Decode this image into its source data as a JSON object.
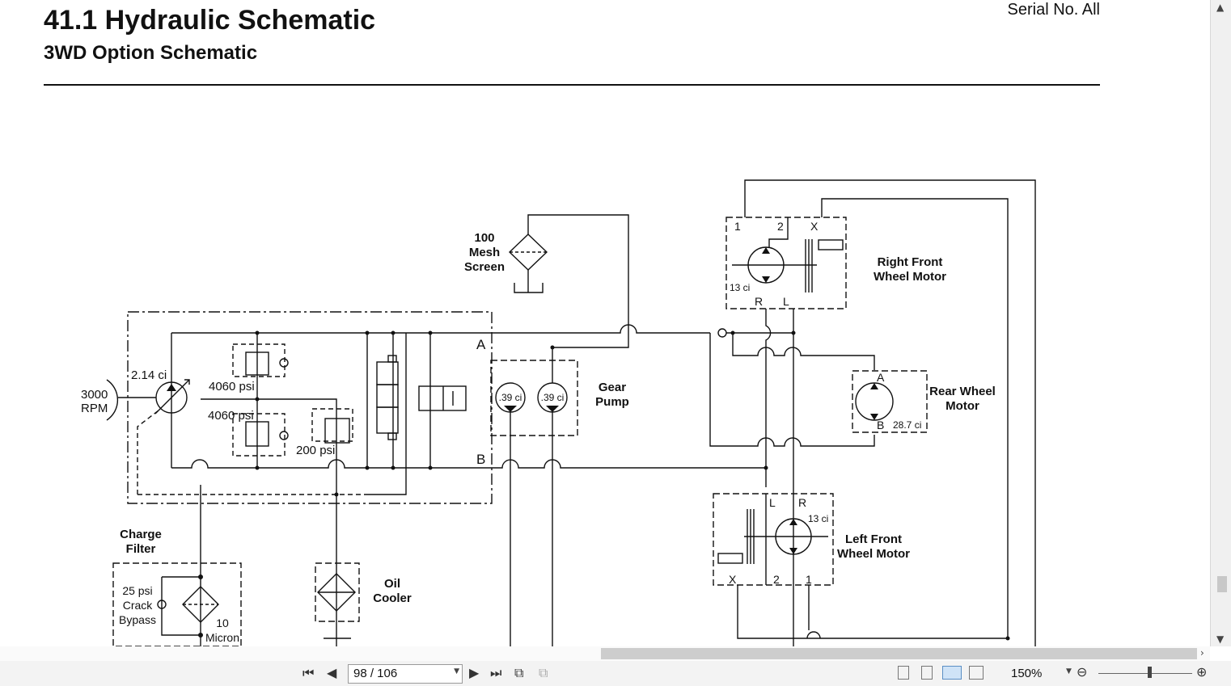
{
  "header": {
    "title": "41.1 Hydraulic Schematic",
    "subtitle": "3WD Option Schematic",
    "serial": "Serial No. All"
  },
  "schematic": {
    "labels": {
      "rpm_value": "3000",
      "rpm_unit": "RPM",
      "pump_disp": "2.14 ci",
      "relief_upper": "4060 psi",
      "relief_lower": "4060 psi",
      "relief_charge": "200 psi",
      "port_a": "A",
      "port_b": "B",
      "mesh_line1": "100",
      "mesh_line2": "Mesh",
      "mesh_line3": "Screen",
      "gear_pump_line1": "Gear",
      "gear_pump_line2": "Pump",
      "gear_disp_1": ".39 ci",
      "gear_disp_2": ".39 ci",
      "rf_port_1": "1",
      "rf_port_2": "2",
      "rf_port_x": "X",
      "rf_port_r": "R",
      "rf_port_l": "L",
      "rf_disp": "13 ci",
      "rf_line1": "Right Front",
      "rf_line2": "Wheel Motor",
      "rear_port_a": "A",
      "rear_port_b": "B",
      "rear_disp": "28.7 ci",
      "rear_line1": "Rear Wheel",
      "rear_line2": "Motor",
      "lf_port_l": "L",
      "lf_port_r": "R",
      "lf_port_x": "X",
      "lf_port_2": "2",
      "lf_port_1": "1",
      "lf_disp": "13 ci",
      "lf_line1": "Left Front",
      "lf_line2": "Wheel Motor",
      "charge_line1": "Charge",
      "charge_line2": "Filter",
      "bypass_line1": "25 psi",
      "bypass_line2": "Crack",
      "bypass_line3": "Bypass",
      "micron_value": "10",
      "micron_unit": "Micron",
      "cooler_line1": "Oil",
      "cooler_line2": "Cooler"
    }
  },
  "toolbar": {
    "first_icon": "first-page-icon",
    "prev_icon": "previous-page-icon",
    "page_value": "98 / 106",
    "next_icon": "next-page-icon",
    "last_icon": "last-page-icon",
    "zoom": "150%"
  }
}
